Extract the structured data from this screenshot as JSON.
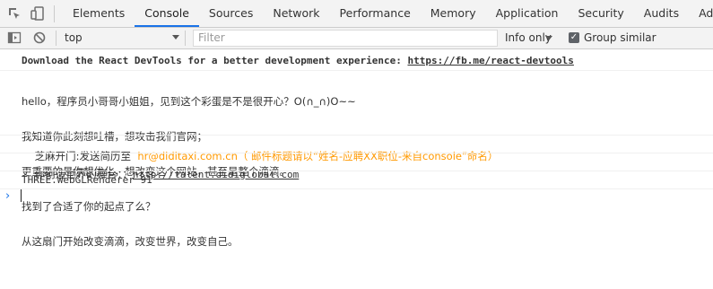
{
  "toolbar": {
    "tabs": [
      {
        "label": "Elements"
      },
      {
        "label": "Console"
      },
      {
        "label": "Sources"
      },
      {
        "label": "Network"
      },
      {
        "label": "Performance"
      },
      {
        "label": "Memory"
      },
      {
        "label": "Application"
      },
      {
        "label": "Security"
      },
      {
        "label": "Audits"
      },
      {
        "label": "AdBlock"
      }
    ],
    "active_tab": "Console",
    "accent_color": "#1a73e8"
  },
  "filterbar": {
    "context": "top",
    "filter_placeholder": "Filter",
    "levels": "Info only",
    "group_similar_label": "Group similar",
    "group_similar_checked": true
  },
  "console": {
    "devtools_prefix": "Download the React DevTools for a better development experience: ",
    "devtools_link": "https://fb.me/react-devtools",
    "greeting_lines": [
      "hello，程序员小哥哥小姐姐，见到这个彩蛋是不是很开心？O(∩_∩)O~~",
      "我知道你此刻想吐槽，想攻击我们官网；",
      "更重要的是你想优化，想改变这个网站，甚至是整个滴滴。",
      "找到了合适了你的起点了么？",
      "从这扇门开始改变滴滴，改变世界，改变自己。"
    ],
    "resume_label": "芝麻开门:发送简历至",
    "resume_email": "hr@diditaxi.com.cn",
    "resume_note": "（ 邮件标题请以“姓名-应聘XX职位-来自console”命名）",
    "resume_color": "#ff9900",
    "stage_label": "你创造世界的舞台：：",
    "stage_link": "http://talent.didiglobal.com",
    "three_log": "THREE.WebGLRenderer 91",
    "prompt_symbol": "›"
  }
}
